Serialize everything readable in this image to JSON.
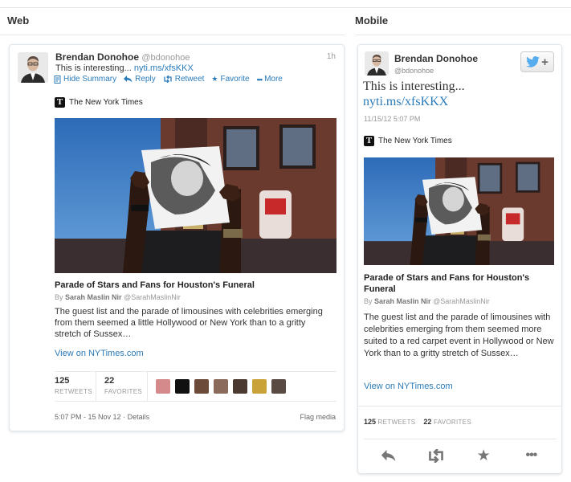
{
  "sections": {
    "web": "Web",
    "mobile": "Mobile"
  },
  "tweet": {
    "name": "Brendan Donohoe",
    "handle": "@bdonohoe",
    "text": "This is interesting...",
    "link": "nyti.ms/xfsKKX",
    "web_time": "1h",
    "mobile_date": "11/15/12 5:07 PM"
  },
  "web_actions": [
    {
      "label": "Hide Summary",
      "icon": "summary-icon"
    },
    {
      "label": "Reply",
      "icon": "reply-icon"
    },
    {
      "label": "Retweet",
      "icon": "retweet-icon"
    },
    {
      "label": "Favorite",
      "icon": "star-icon"
    },
    {
      "label": "More",
      "icon": "more-icon"
    }
  ],
  "card": {
    "publisher": "The New York Times",
    "headline": "Parade of Stars and Fans for Houston's Funeral",
    "author": "Sarah Maslin Nir",
    "author_handle": "@SarahMaslinNir",
    "web_summary": "The guest list and the parade of limousines with celebrities emerging from them seemed a little Hollywood or New York than to a gritty stretch of Sussex…",
    "mobile_summary": "The guest list and the parade of limousines with celebrities emerging from them seemed more suited to a red carpet event in Hollywood or New York than to a gritty stretch of Sussex…",
    "view_link": "View on NYTimes.com",
    "byline_prefix": "By"
  },
  "stats": {
    "retweets": "125",
    "retweets_label": "RETWEETS",
    "favorites": "22",
    "favorites_label": "FAVORITES"
  },
  "web_footer": {
    "timestamp": "5:07 PM - 15 Nov 12",
    "details": "Details",
    "flag": "Flag media"
  },
  "colors": {
    "link": "#2b7bb9",
    "twitter_blue": "#55acee",
    "border": "#e1e8ed",
    "muted": "#999999"
  }
}
